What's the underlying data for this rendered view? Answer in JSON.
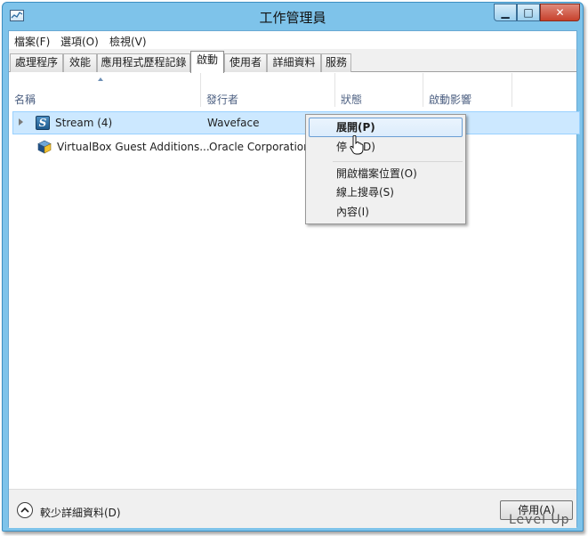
{
  "window": {
    "title": "工作管理員"
  },
  "menu": [
    "檔案(F)",
    "選項(O)",
    "檢視(V)"
  ],
  "tabs": [
    "處理程序",
    "效能",
    "應用程式歷程記錄",
    "啟動",
    "使用者",
    "詳細資料",
    "服務"
  ],
  "columns": [
    "名稱",
    "發行者",
    "狀態",
    "啟動影響"
  ],
  "rows": [
    {
      "name": "Stream (4)",
      "publisher": "Waveface",
      "icon": "stream-s-icon"
    },
    {
      "name": "VirtualBox Guest Additions...",
      "publisher": "Oracle Corporation",
      "icon": "virtualbox-cube-icon"
    }
  ],
  "context_menu": [
    "展開(P)",
    "停用(D)",
    "開啟檔案位置(O)",
    "線上搜尋(S)",
    "內容(I)"
  ],
  "context_menu_visible_disable": [
    "停",
    "D)"
  ],
  "footer": {
    "collapse_label": "較少詳細資料(D)",
    "disable_button": "停用(A)"
  },
  "watermark": "Level Up",
  "colors": {
    "title_bar": "#7ec3ea",
    "selection": "#cce8ff",
    "close_button": "#c7412c"
  }
}
